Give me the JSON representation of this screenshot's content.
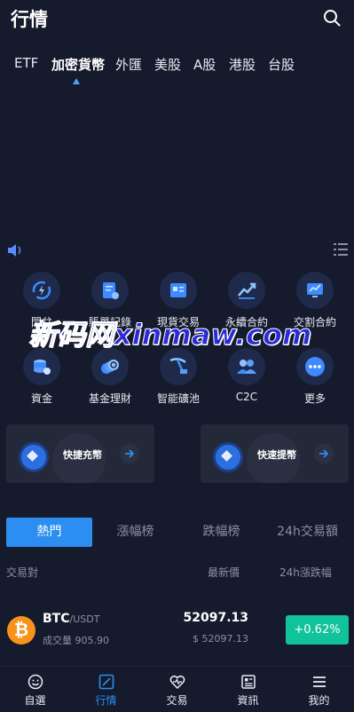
{
  "header": {
    "title": "行情",
    "search_icon": "search-icon"
  },
  "tabs": [
    {
      "label": "ETF",
      "active": false
    },
    {
      "label": "加密貨幣",
      "active": true
    },
    {
      "label": "外匯",
      "active": false
    },
    {
      "label": "美股",
      "active": false
    },
    {
      "label": "A股",
      "active": false
    },
    {
      "label": "港股",
      "active": false
    },
    {
      "label": "台股",
      "active": false
    }
  ],
  "notice": {
    "speaker_icon": "speaker-icon",
    "list_icon": "list-icon"
  },
  "grid": [
    {
      "label": "閃兌",
      "icon": "exchange-icon"
    },
    {
      "label": "賬單記錄",
      "icon": "bill-icon"
    },
    {
      "label": "現貨交易",
      "icon": "spot-icon"
    },
    {
      "label": "永續合約",
      "icon": "chart-up-icon"
    },
    {
      "label": "交割合約",
      "icon": "monitor-chart-icon"
    },
    {
      "label": "資金",
      "icon": "coins-icon"
    },
    {
      "label": "基金理財",
      "icon": "coin-stack-icon"
    },
    {
      "label": "智能礦池",
      "icon": "mining-icon"
    },
    {
      "label": "C2C",
      "icon": "users-icon"
    },
    {
      "label": "更多",
      "icon": "more-icon"
    }
  ],
  "watermark": "新码网xinmaw.com",
  "cards": [
    {
      "label": "快捷充幣"
    },
    {
      "label": "快速提幣"
    }
  ],
  "rank_tabs": [
    {
      "label": "熱門",
      "active": true
    },
    {
      "label": "漲幅榜",
      "active": false
    },
    {
      "label": "跌幅榜",
      "active": false
    },
    {
      "label": "24h交易額",
      "active": false
    }
  ],
  "columns": {
    "pair": "交易對",
    "price": "最新價",
    "change": "24h漲跌幅"
  },
  "rows": [
    {
      "symbol": "BTC",
      "quote": "/USDT",
      "volume": "成交量 905.90",
      "price": "52097.13",
      "price_usd": "$ 52097.13",
      "change": "+0.62%",
      "logo": "₿"
    }
  ],
  "nav": [
    {
      "label": "自選",
      "active": false,
      "icon": "smile-icon"
    },
    {
      "label": "行情",
      "active": true,
      "icon": "market-icon"
    },
    {
      "label": "交易",
      "active": false,
      "icon": "trade-icon"
    },
    {
      "label": "資訊",
      "active": false,
      "icon": "news-icon"
    },
    {
      "label": "我的",
      "active": false,
      "icon": "menu-icon"
    }
  ],
  "colors": {
    "accent": "#2b8ef0",
    "up": "#11c39b",
    "bg": "#151a2c",
    "btc": "#f7931a"
  }
}
